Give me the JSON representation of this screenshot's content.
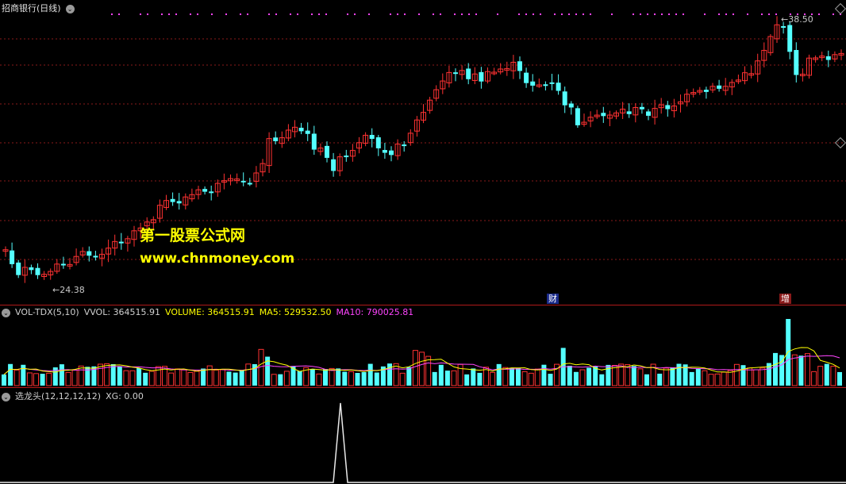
{
  "price_panel": {
    "title": "招商银行(日线)",
    "high_label": "38.50",
    "low_label": "24.38",
    "event_tag_1": "财",
    "event_tag_2": "增",
    "watermark_title": "第一股票公式网",
    "watermark_url": "www.chnmoney.com"
  },
  "volume_panel": {
    "indicator": "VOL-TDX(5,10)",
    "vvol": "VVOL: 364515.91",
    "volume": "VOLUME: 364515.91",
    "ma5": "MA5: 529532.50",
    "ma10": "MA10: 790025.81"
  },
  "xg_panel": {
    "indicator": "选龙头(12,12,12,12)",
    "xg": "XG: 0.00"
  },
  "colors": {
    "up": "#ff3232",
    "down": "#54ffff",
    "ma5": "#ffff00",
    "ma10": "#ff44ff",
    "grid": "#8a1a1a",
    "separator": "#b01818"
  },
  "icons": [
    "collapse-circle-icon",
    "diamond-marker-icon"
  ]
}
